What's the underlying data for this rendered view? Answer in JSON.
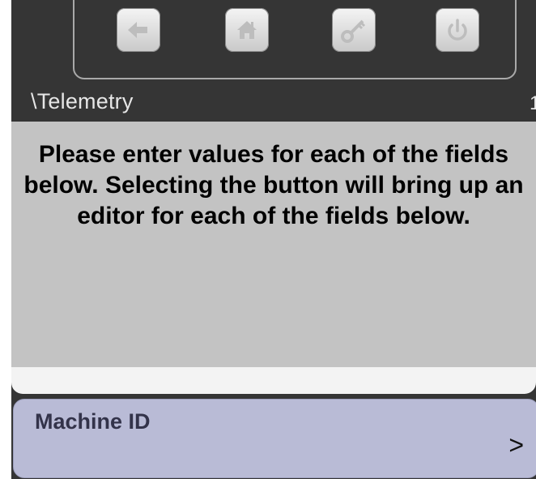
{
  "toolbar": {
    "buttons": [
      {
        "name": "back-button",
        "icon": "left-arrow-icon"
      },
      {
        "name": "home-button",
        "icon": "home-icon"
      },
      {
        "name": "login-button",
        "icon": "key-icon"
      },
      {
        "name": "power-button",
        "icon": "power-icon"
      }
    ]
  },
  "header": {
    "path": "\\Telemetry",
    "corner_text": "1"
  },
  "instruction": {
    "text": "Please enter values for each of the fields below. Selecting the button will bring up an editor for each of the fields below."
  },
  "fields": [
    {
      "label": "Machine ID",
      "chevron": ">"
    }
  ],
  "colors": {
    "background": "#353535",
    "instruction_bg": "#c3c3c3",
    "field_bg": "#b9bbd6",
    "icon_color": "#bdbdbd"
  }
}
